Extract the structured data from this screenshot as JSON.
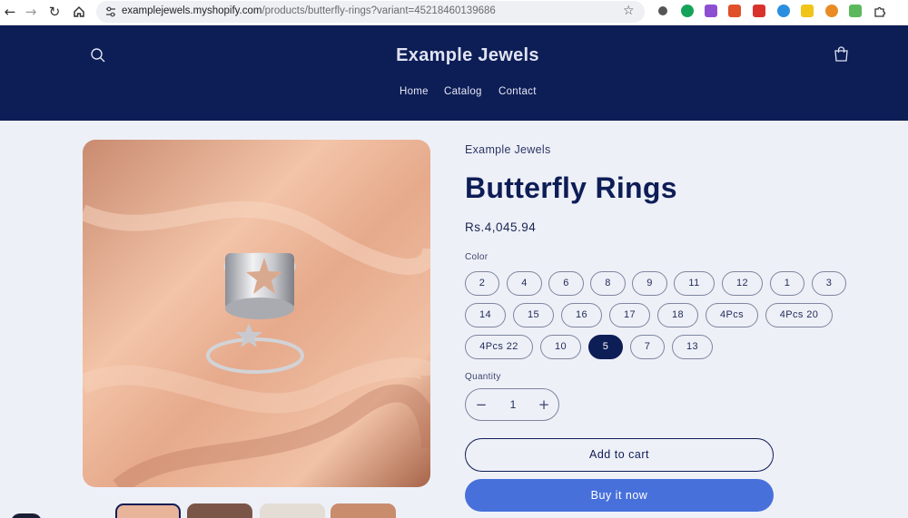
{
  "browser": {
    "url_host": "examplejewels.myshopify.com",
    "url_path": "/products/butterfly-rings?variant=45218460139686",
    "icons": [
      "back-arrow-icon",
      "forward-arrow-icon",
      "reload-icon",
      "home-icon",
      "site-settings-icon",
      "bookmark-star-icon",
      "extensions-puzzle-icon"
    ]
  },
  "header": {
    "brand": "Example Jewels",
    "nav": [
      "Home",
      "Catalog",
      "Contact"
    ]
  },
  "product": {
    "vendor": "Example Jewels",
    "title": "Butterfly Rings",
    "price": "Rs.4,045.94",
    "option_label": "Color",
    "options": [
      "2",
      "4",
      "6",
      "8",
      "9",
      "11",
      "12",
      "1",
      "3",
      "14",
      "15",
      "16",
      "17",
      "18",
      "4Pcs",
      "4Pcs 20",
      "4Pcs 22",
      "10",
      "5",
      "7",
      "13"
    ],
    "selected_option": "5",
    "quantity_label": "Quantity",
    "quantity": "1",
    "add_to_cart": "Add to cart",
    "buy_now": "Buy it now"
  },
  "colors": {
    "header_bg": "#0d1d56",
    "page_bg": "#eef0f7",
    "accent": "#4770db"
  }
}
